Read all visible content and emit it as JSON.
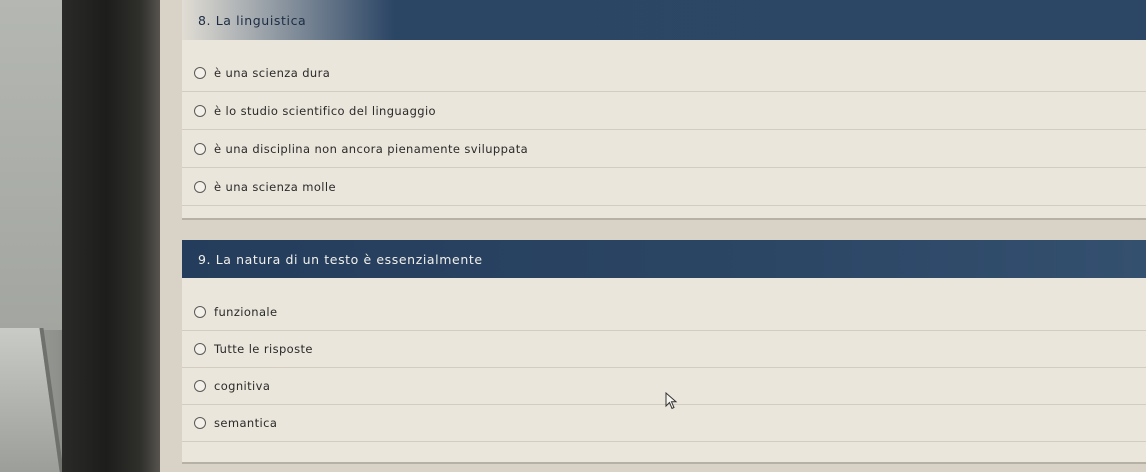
{
  "questions": [
    {
      "title": "8. La linguistica",
      "options": [
        "è una scienza dura",
        "è lo studio scientifico del linguaggio",
        "è una disciplina non ancora pienamente sviluppata",
        "è una scienza molle"
      ]
    },
    {
      "title": "9. La natura di un testo è essenzialmente",
      "options": [
        "funzionale",
        "Tutte le risposte",
        "cognitiva",
        "semantica"
      ]
    }
  ],
  "colors": {
    "header_background": "#2b4565",
    "panel_background": "#ebe6dc"
  },
  "icons": {
    "radio": "radio-button-icon",
    "cursor": "mouse-pointer-icon"
  }
}
